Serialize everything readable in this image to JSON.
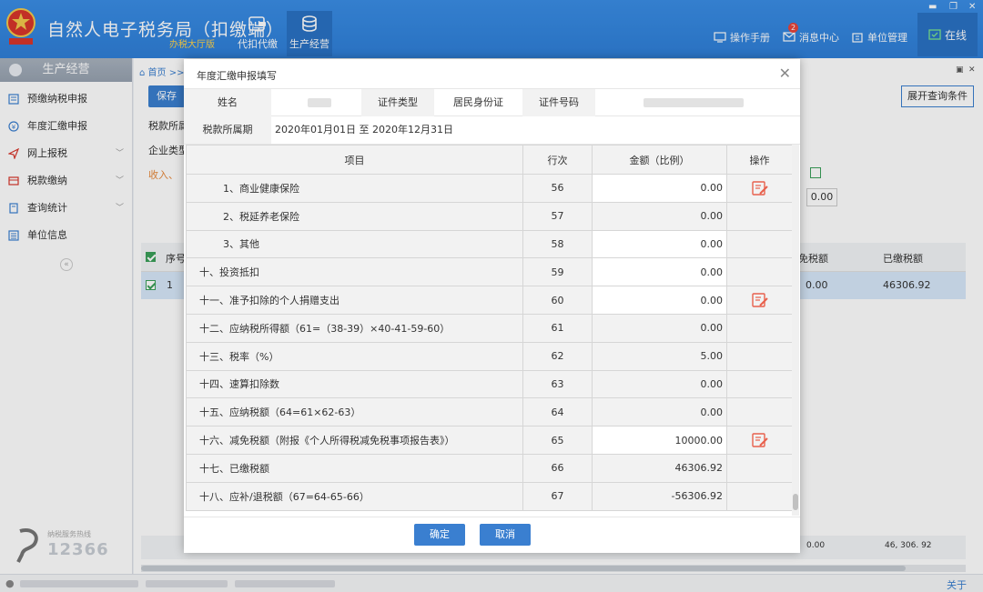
{
  "header": {
    "app_title": "自然人电子税务局（扣缴端）",
    "app_subtitle": "办税大厅版",
    "nav": [
      {
        "label": "代扣代缴",
        "icon": "withholding-icon"
      },
      {
        "label": "生产经营",
        "icon": "coins-icon",
        "active": true
      }
    ],
    "links": {
      "manual": "操作手册",
      "messages": "消息中心",
      "message_count": "2",
      "unit_mgmt": "单位管理",
      "online": "在线"
    }
  },
  "sidebar": {
    "title": "生产经营",
    "items": [
      {
        "label": "预缴纳税申报",
        "icon": "declare-icon"
      },
      {
        "label": "年度汇缴申报",
        "icon": "annual-icon"
      },
      {
        "label": "网上报税",
        "icon": "send-icon",
        "has_children": true
      },
      {
        "label": "税款缴纳",
        "icon": "payment-icon",
        "has_children": true
      },
      {
        "label": "查询统计",
        "icon": "query-icon",
        "has_children": true
      },
      {
        "label": "单位信息",
        "icon": "unit-info-icon"
      }
    ],
    "hotline_label": "纳税服务热线",
    "hotline_number": "12366"
  },
  "main": {
    "breadcrumb": "首页 >>",
    "save_label": "保存",
    "expand_label": "展开查询条件",
    "field_period_label": "税款所属",
    "field_type_label": "企业类型",
    "red_label": "收入、",
    "small_input_value": "0.00",
    "table_headers": {
      "checkbox": "",
      "seq": "序号",
      "reduced": "免税额",
      "paid": "已缴税额"
    },
    "table_row": {
      "seq": "1",
      "reduced": "0.00",
      "paid": "46306.92"
    },
    "footer_reduced": "0.00",
    "footer_paid": "46, 306. 92"
  },
  "status_bar": {
    "about": "关于"
  },
  "modal": {
    "title": "年度汇缴申报填写",
    "info": {
      "name_label": "姓名",
      "id_type_label": "证件类型",
      "id_type_value": "居民身份证",
      "id_number_label": "证件号码",
      "period_label": "税款所属期",
      "period_value": "2020年01月01日 至 2020年12月31日"
    },
    "table": {
      "headers": {
        "item": "项目",
        "line": "行次",
        "amount": "金额（比例）",
        "op": "操作"
      },
      "rows": [
        {
          "item": "1、商业健康保险",
          "line": "56",
          "amount": "0.00"
        },
        {
          "item": "2、税延养老保险",
          "line": "57",
          "amount": "0.00"
        },
        {
          "item": "3、其他",
          "line": "58",
          "amount": "0.00"
        },
        {
          "item": "十、投资抵扣",
          "line": "59",
          "amount": "0.00"
        },
        {
          "item": "十一、准予扣除的个人捐赠支出",
          "line": "60",
          "amount": "0.00"
        },
        {
          "item": "十二、应纳税所得额（61=（38-39）×40-41-59-60）",
          "line": "61",
          "amount": "0.00"
        },
        {
          "item": "十三、税率（%）",
          "line": "62",
          "amount": "5.00"
        },
        {
          "item": "十四、速算扣除数",
          "line": "63",
          "amount": "0.00"
        },
        {
          "item": "十五、应纳税额（64=61×62-63）",
          "line": "64",
          "amount": "0.00"
        },
        {
          "item": "十六、减免税额（附报《个人所得税减免税事项报告表》）",
          "line": "65",
          "amount": "10000.00"
        },
        {
          "item": "十七、已缴税额",
          "line": "66",
          "amount": "46306.92"
        },
        {
          "item": "十八、应补/退税额（67=64-65-66）",
          "line": "67",
          "amount": "-56306.92"
        }
      ]
    },
    "confirm_label": "确定",
    "cancel_label": "取消"
  }
}
